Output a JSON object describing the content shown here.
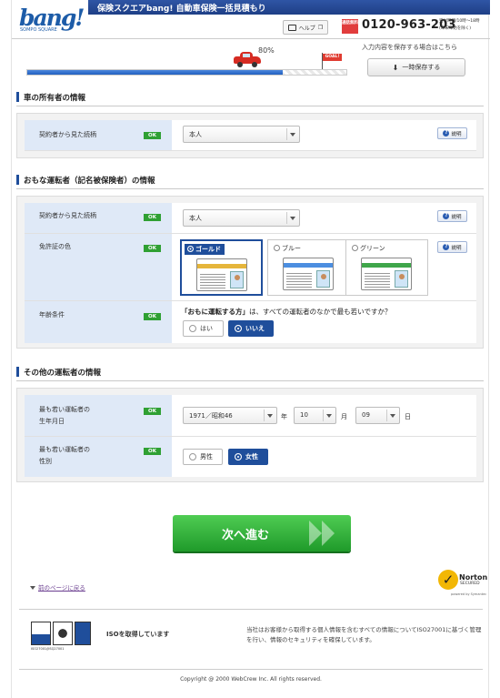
{
  "header": {
    "logo_text": "bang!",
    "logo_small": "SOMPO SQUARE",
    "banner": "保険スクエアbang! 自動車保険一括見積もり",
    "help_label": "ヘルプ",
    "free_badge": "通話無料",
    "phone": "0120-963-203",
    "hours_line1": "受付時間/10時〜18時",
    "hours_line2": "(年末年始を除く)"
  },
  "progress": {
    "percent_label": "80%",
    "value": 0.8,
    "goal_label": "GOAL!",
    "save_note": "入力内容を保存する場合はこちら",
    "save_button": "一時保存する"
  },
  "owner_section": {
    "title": "車の所有者の情報",
    "rows": [
      {
        "label": "契約者から見た続柄",
        "status": "OK",
        "value": "本人",
        "help": "説明"
      }
    ]
  },
  "driver_section": {
    "title": "おもな運転者（記名被保険者）の情報",
    "relation": {
      "label": "契約者から見た続柄",
      "status": "OK",
      "value": "本人",
      "help": "説明"
    },
    "license": {
      "label": "免許証の色",
      "status": "OK",
      "help": "説明",
      "options": [
        {
          "name": "ゴールド",
          "selected": true,
          "color": "#e5b53b"
        },
        {
          "name": "ブルー",
          "selected": false,
          "color": "#4c8ee0"
        },
        {
          "name": "グリーン",
          "selected": false,
          "color": "#3fa64a"
        }
      ]
    },
    "age": {
      "label": "年齢条件",
      "status": "OK",
      "question_bold": "「おもに運転する方」",
      "question_rest": "は、すべての運転者のなかで最も若いですか？",
      "options": [
        {
          "name": "はい",
          "selected": false
        },
        {
          "name": "いいえ",
          "selected": true
        }
      ]
    }
  },
  "other_section": {
    "title": "その他の運転者の情報",
    "birth": {
      "label1": "最も若い運転者の",
      "label2": "生年月日",
      "status": "OK",
      "year": "1971／昭和46",
      "year_unit": "年",
      "month": "10",
      "month_unit": "月",
      "day": "09",
      "day_unit": "日"
    },
    "gender": {
      "label1": "最も若い運転者の",
      "label2": "性別",
      "status": "OK",
      "options": [
        {
          "name": "男性",
          "selected": false
        },
        {
          "name": "女性",
          "selected": true
        }
      ]
    }
  },
  "footer": {
    "next_button": "次へ進む",
    "back_link": "前のページに戻る",
    "norton_name": "Norton",
    "norton_secured": "SECURED",
    "norton_powered": "powered by Symantec",
    "iso_caption": "ISO27001/JISQ27001",
    "iso_text": "ISOを取得しています",
    "privacy": "当社はお客様から取得する個人情報を含むすべての情報についてISO27001に基づく管理を行い、情報のセキュリティを確保しています。",
    "copyright": "Copyright @ 2000 WebCrew Inc. All rights reserved."
  }
}
